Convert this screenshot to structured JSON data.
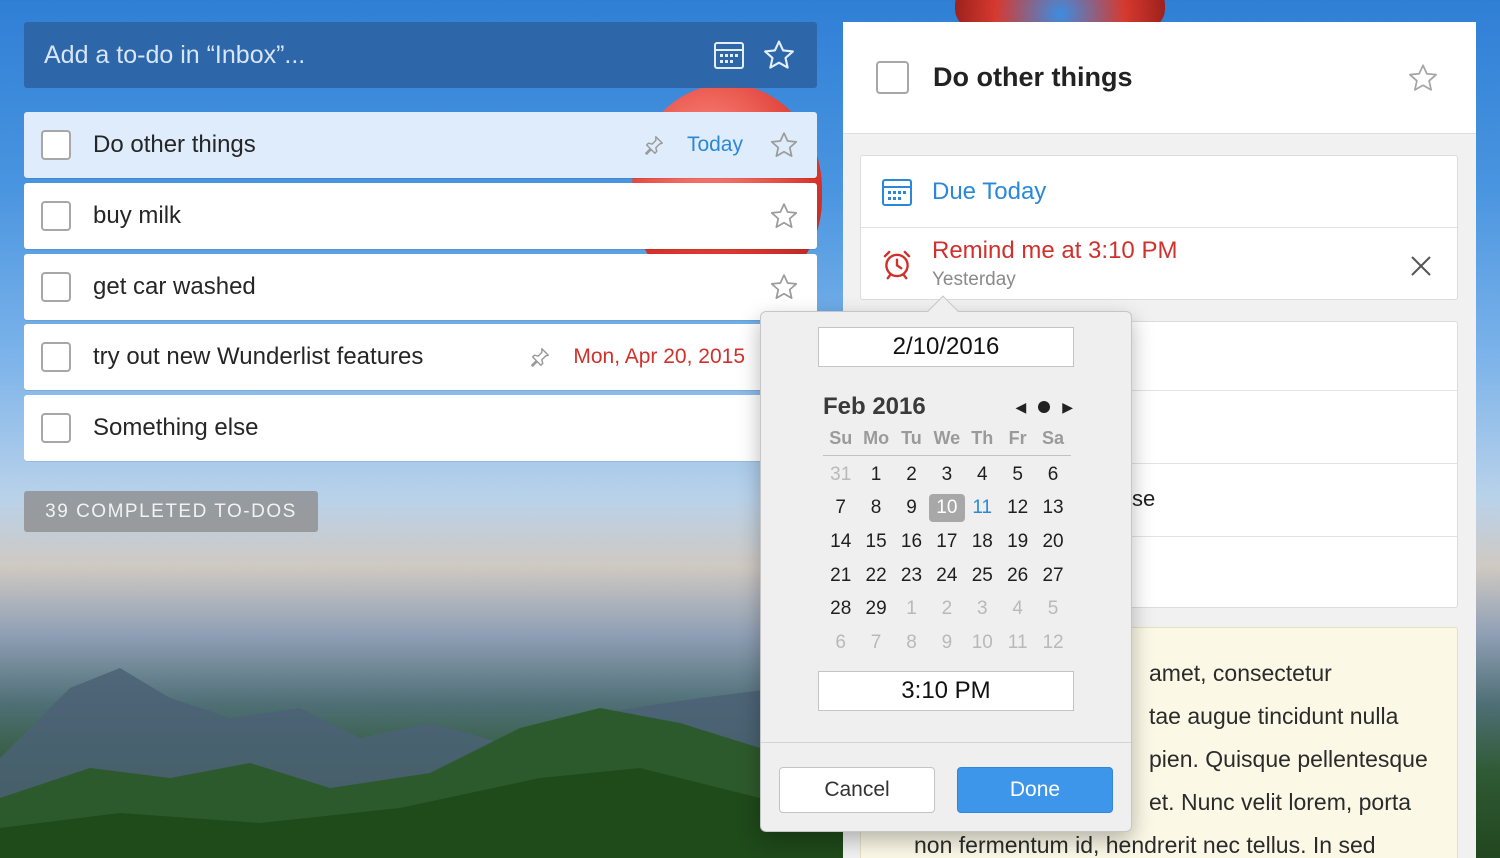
{
  "add_bar": {
    "placeholder": "Add a to-do in “Inbox”...",
    "icons": [
      "calendar-icon",
      "star-icon"
    ]
  },
  "tasks": [
    {
      "title": "Do other things",
      "due": "Today",
      "due_color": "#2b88d9",
      "pinned": true,
      "selected": true
    },
    {
      "title": "buy milk",
      "due": "",
      "pinned": false,
      "selected": false
    },
    {
      "title": "get car washed",
      "due": "",
      "pinned": false,
      "selected": false
    },
    {
      "title": "try out new Wunderlist features",
      "due": "Mon, Apr 20, 2015",
      "due_color": "#d0312d",
      "pinned": true,
      "selected": false
    },
    {
      "title": "Something else",
      "due": "",
      "pinned": false,
      "selected": false
    }
  ],
  "completed_button": "39 COMPLETED TO-DOS",
  "detail": {
    "title": "Do other things",
    "due_label": "Due Today",
    "reminder_label": "Remind me at 3:10 PM",
    "reminder_sub": "Yesterday",
    "partial_subtask_text": "se",
    "note_lines": [
      "amet, consectetur",
      "tae augue tincidunt nulla",
      "pien. Quisque pellentesque",
      "et. Nunc velit lorem, porta",
      "non fermentum id, hendrerit nec tellus. In sed"
    ]
  },
  "picker": {
    "date_value": "2/10/2016",
    "month_label": "Feb 2016",
    "weekdays": [
      "Su",
      "Mo",
      "Tu",
      "We",
      "Th",
      "Fr",
      "Sa"
    ],
    "weeks": [
      [
        "31",
        "1",
        "2",
        "3",
        "4",
        "5",
        "6"
      ],
      [
        "7",
        "8",
        "9",
        "10",
        "11",
        "12",
        "13"
      ],
      [
        "14",
        "15",
        "16",
        "17",
        "18",
        "19",
        "20"
      ],
      [
        "21",
        "22",
        "23",
        "24",
        "25",
        "26",
        "27"
      ],
      [
        "28",
        "29",
        "1",
        "2",
        "3",
        "4",
        "5"
      ],
      [
        "6",
        "7",
        "8",
        "9",
        "10",
        "11",
        "12"
      ]
    ],
    "selected_day": "10",
    "today_day": "11",
    "time_value": "3:10 PM",
    "cancel_label": "Cancel",
    "done_label": "Done"
  },
  "colors": {
    "accent_blue": "#2b88d9",
    "overdue_red": "#d0312d",
    "done_button": "#3d96ea",
    "note_bg": "#fbf8e6"
  }
}
